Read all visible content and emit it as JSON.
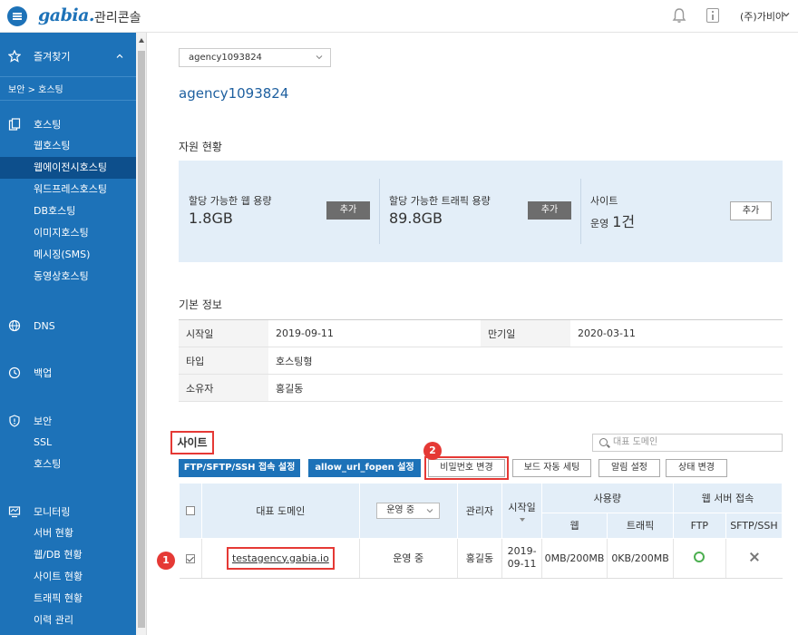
{
  "header": {
    "logo": "gabia.",
    "console_title": "관리콘솔",
    "account": "(주)가비아"
  },
  "sidebar": {
    "favorites": "즐겨찾기",
    "breadcrumb": "보안 > 호스팅",
    "hosting": {
      "title": "호스팅",
      "items": [
        "웹호스팅",
        "웹에이전시호스팅",
        "워드프레스호스팅",
        "DB호스팅",
        "이미지호스팅",
        "메시징(SMS)",
        "동영상호스팅"
      ],
      "active_index": 1
    },
    "dns": "DNS",
    "backup": "백업",
    "security": {
      "title": "보안",
      "items": [
        "SSL",
        "호스팅"
      ]
    },
    "monitoring": {
      "title": "모니터링",
      "items": [
        "서버 현황",
        "웹/DB 현황",
        "사이트 현황",
        "트래픽 현황",
        "이력 관리"
      ]
    }
  },
  "main": {
    "account_select": "agency1093824",
    "account_title": "agency1093824",
    "resource": {
      "title": "자원 현황",
      "web": {
        "label": "할당 가능한 웹 용량",
        "value": "1.8GB",
        "button": "추가"
      },
      "traffic": {
        "label": "할당 가능한 트래픽 용량",
        "value": "89.8GB",
        "button": "추가"
      },
      "site": {
        "label": "사이트",
        "prefix": "운영",
        "value": "1건",
        "button": "추가"
      }
    },
    "basic": {
      "title": "기본 정보",
      "start_label": "시작일",
      "start_value": "2019-09-11",
      "end_label": "만기일",
      "end_value": "2020-03-11",
      "type_label": "타입",
      "type_value": "호스팅형",
      "owner_label": "소유자",
      "owner_value": "홍길동"
    },
    "sites": {
      "title": "사이트",
      "search_placeholder": "대표 도메인",
      "buttons": {
        "ftp": "FTP/SFTP/SSH 접속 설정",
        "allow_url": "allow_url_fopen 설정",
        "password": "비밀번호 변경",
        "board": "보드 자동 세팅",
        "alarm": "알림 설정",
        "status": "상태 변경"
      },
      "columns": {
        "domain": "대표 도메인",
        "status_filter": "운영 중",
        "admin": "관리자",
        "start": "시작일",
        "usage": "사용량",
        "web": "웹",
        "traffic": "트래픽",
        "access": "웹 서버 접속",
        "ftp": "FTP",
        "sftp": "SFTP/SSH"
      },
      "rows": [
        {
          "domain": "testagency.gabia.io",
          "status": "운영 중",
          "admin": "홍길동",
          "start": "2019-09-11",
          "web": "0MB/200MB",
          "traffic": "0KB/200MB"
        }
      ]
    },
    "badges": {
      "one": "1",
      "two": "2"
    }
  }
}
